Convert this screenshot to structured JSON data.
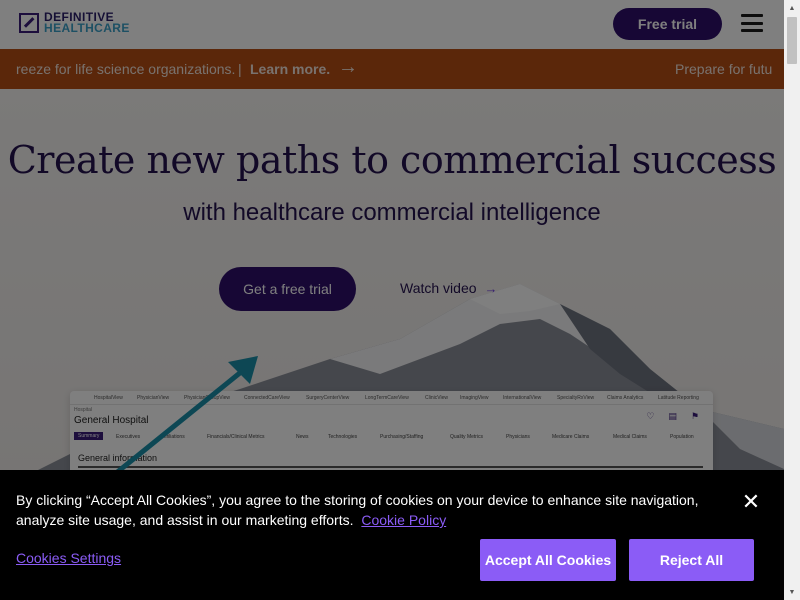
{
  "header": {
    "logo_line1": "DEFINITIVE",
    "logo_line2": "HEALTHCARE",
    "free_trial_label": "Free trial"
  },
  "banner": {
    "text_left": "reeze for life science organizations.",
    "separator": "|",
    "learn_more": "Learn more.",
    "arrow": "→",
    "text_right": "Prepare for futu",
    "background_color": "#b64f15"
  },
  "hero": {
    "title": "Create new paths to commercial success",
    "subtitle": "with healthcare commercial intelligence",
    "primary_cta": "Get a free trial",
    "secondary_cta": "Watch video",
    "secondary_arrow": "→"
  },
  "preview": {
    "nav_items": [
      "HospitalView",
      "PhysicianView",
      "PhysicianGroupView",
      "ConnectedCareView",
      "SurgeryCenterView",
      "LongTermCareView",
      "ClinicView",
      "ImagingView",
      "InternationalView",
      "SpecialtyRxView",
      "Claims Analytics",
      "Latitude Reporting"
    ],
    "breadcrumb": "Hospital",
    "title": "General Hospital",
    "tabs": [
      "Summary",
      "Executives",
      "Affiliations",
      "Financials/Clinical Metrics",
      "News",
      "Technologies",
      "Purchasing/Staffing",
      "Quality Metrics",
      "Physicians",
      "Medicare Claims",
      "Medical Claims",
      "Population"
    ],
    "section_title": "General information"
  },
  "cookie": {
    "text": "By clicking “Accept All Cookies”, you agree to the storing of cookies on your device to enhance site navigation, analyze site usage, and assist in our marketing efforts.",
    "policy_link": "Cookie Policy",
    "settings_label": "Cookies Settings",
    "accept_label": "Accept All Cookies",
    "reject_label": "Reject All",
    "close_symbol": "✕",
    "accent_color": "#8b5cf6"
  },
  "scrollbar": {
    "up_symbol": "▲",
    "down_symbol": "▼"
  }
}
